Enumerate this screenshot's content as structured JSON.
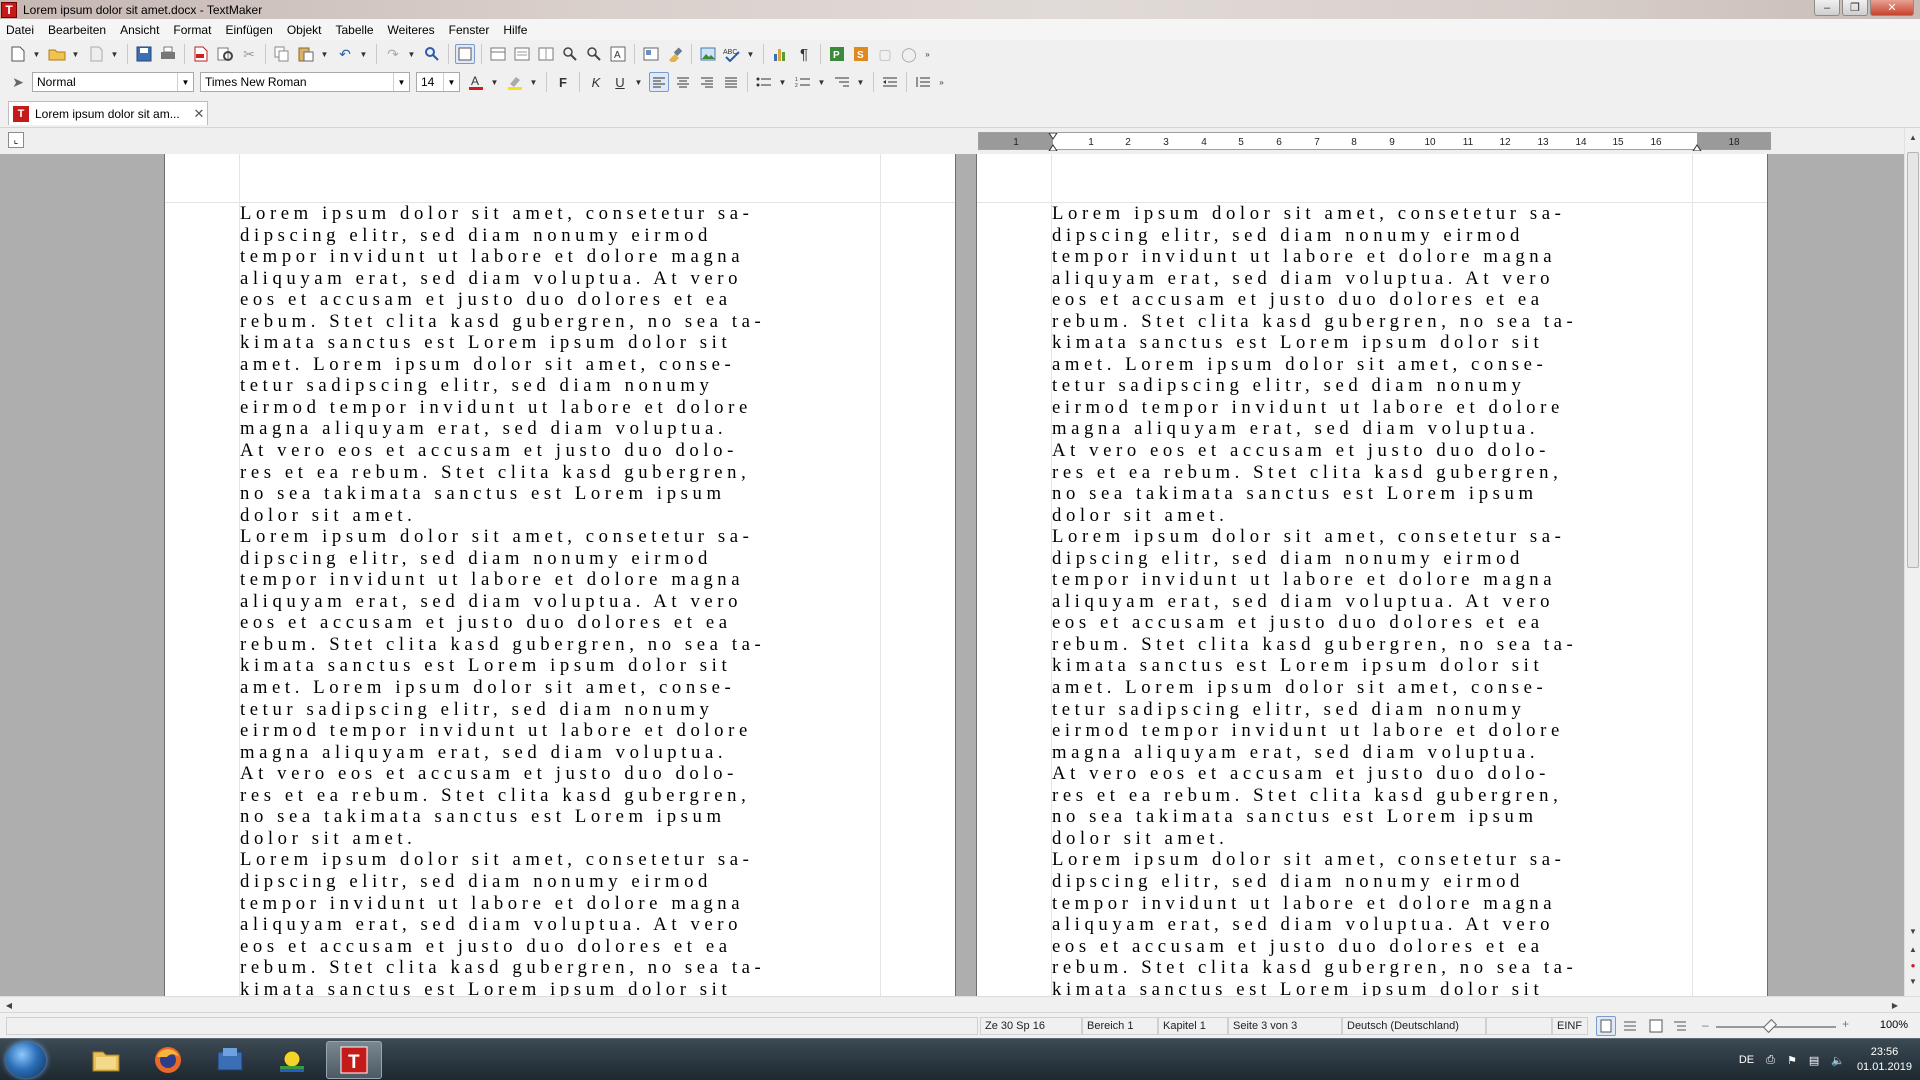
{
  "window": {
    "title": "Lorem ipsum dolor sit amet.docx - TextMaker",
    "app_icon_letter": "T"
  },
  "menu": [
    "Datei",
    "Bearbeiten",
    "Ansicht",
    "Format",
    "Einfügen",
    "Objekt",
    "Tabelle",
    "Weiteres",
    "Fenster",
    "Hilfe"
  ],
  "format_bar": {
    "style": "Normal",
    "font": "Times New Roman",
    "size": "14"
  },
  "tab": {
    "label": "Lorem ipsum dolor sit am..."
  },
  "ruler": {
    "labels": [
      "1",
      "1",
      "2",
      "3",
      "4",
      "5",
      "6",
      "7",
      "8",
      "9",
      "10",
      "11",
      "12",
      "13",
      "14",
      "15",
      "16",
      "18"
    ]
  },
  "document": {
    "paragraph": "Lorem ipsum dolor sit amet, consetetur sa-\ndipscing elitr, sed diam nonumy eirmod\ntempor invidunt ut labore et dolore magna\naliquyam erat, sed diam voluptua. At vero\neos et accusam et justo duo dolores et ea\nrebum. Stet clita kasd gubergren, no sea ta-\nkimata sanctus est Lorem ipsum dolor sit\namet. Lorem ipsum dolor sit amet, conse-\ntetur sadipscing elitr, sed diam nonumy\neirmod tempor invidunt ut labore et dolore\nmagna aliquyam erat, sed diam voluptua.\nAt vero eos et accusam et justo duo dolo-\nres et ea rebum. Stet clita kasd gubergren,\nno sea takimata sanctus est Lorem ipsum\ndolor sit amet.",
    "paragraph_partial": "Lorem ipsum dolor sit amet, consetetur sa-\ndipscing elitr, sed diam nonumy eirmod\ntempor invidunt ut labore et dolore magna\naliquyam erat, sed diam voluptua. At vero\neos et accusam et justo duo dolores et ea\nrebum. Stet clita kasd gubergren, no sea ta-\nkimata sanctus est Lorem ipsum dolor sit"
  },
  "status": {
    "position": "Ze 30 Sp 16",
    "section": "Bereich 1",
    "chapter": "Kapitel 1",
    "page": "Seite 3 von 3",
    "language": "Deutsch (Deutschland)",
    "mode": "EINF",
    "zoom": "100%"
  },
  "taskbar": {
    "language": "DE",
    "time": "23:56",
    "date": "01.01.2019"
  }
}
